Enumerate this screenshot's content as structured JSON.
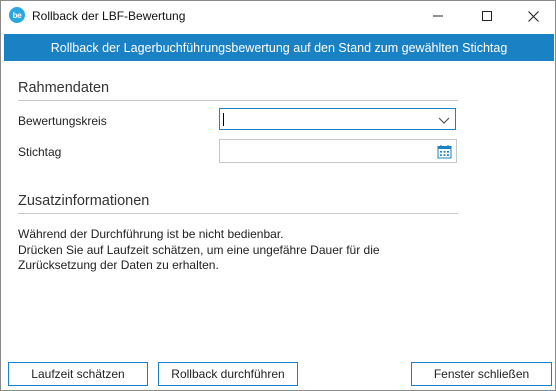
{
  "window": {
    "title": "Rollback der LBF-Bewertung",
    "app_icon_text": "be"
  },
  "banner": {
    "text": "Rollback der Lagerbuchführungsbewertung auf den Stand zum gewählten Stichtag"
  },
  "rahmendaten": {
    "heading": "Rahmendaten",
    "bewertungskreis_label": "Bewertungskreis",
    "bewertungskreis_value": "",
    "stichtag_label": "Stichtag",
    "stichtag_value": ""
  },
  "zusatzinformationen": {
    "heading": "Zusatzinformationen",
    "lines": [
      "Während der Durchführung ist be nicht bedienbar.",
      "Drücken Sie auf Laufzeit schätzen, um eine ungefähre Dauer für die",
      "Zurücksetzung der Daten zu erhalten."
    ]
  },
  "buttons": {
    "estimate": "Laufzeit schätzen",
    "rollback": "Rollback durchführen",
    "close": "Fenster schließen"
  },
  "colors": {
    "accent": "#1a82c4",
    "banner_text": "#ffffff"
  }
}
